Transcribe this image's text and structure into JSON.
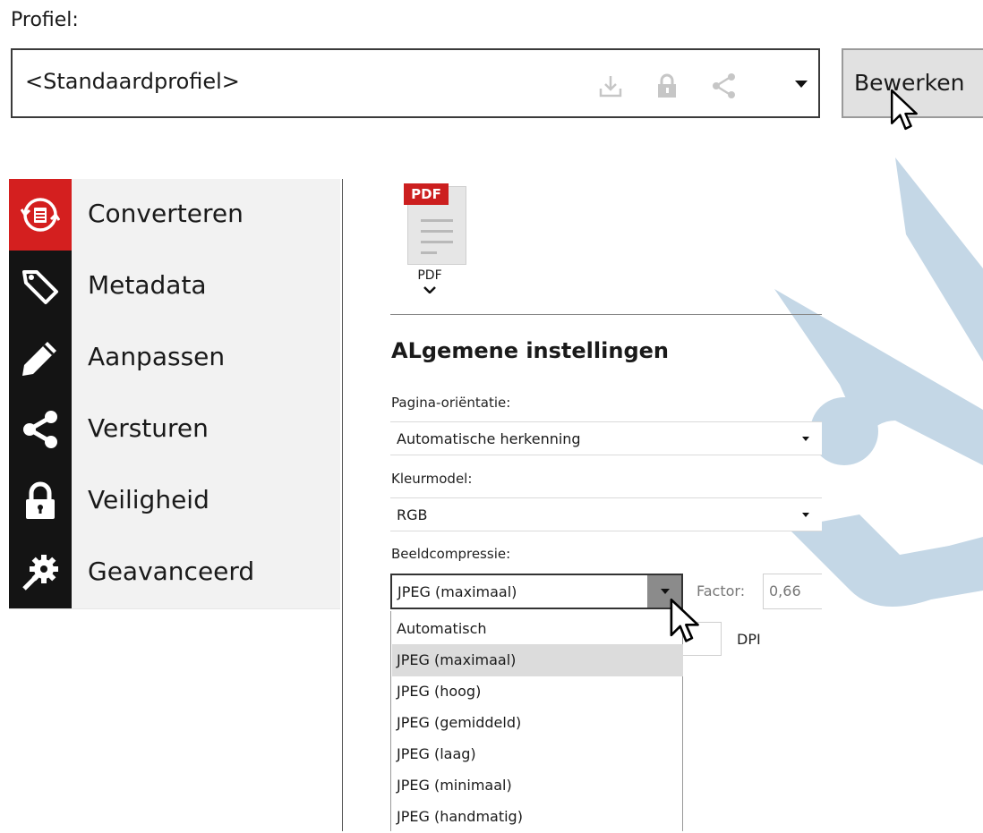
{
  "profile": {
    "label": "Profiel:",
    "selected": "<Standaardprofiel>",
    "icons": [
      "download-icon",
      "lock-icon",
      "share-icon"
    ],
    "edit_label": "Bewerken"
  },
  "sidebar": {
    "items": [
      {
        "label": "Converteren",
        "icon": "convert-icon",
        "active": true
      },
      {
        "label": "Metadata",
        "icon": "tag-icon",
        "active": false
      },
      {
        "label": "Aanpassen",
        "icon": "pencil-icon",
        "active": false
      },
      {
        "label": "Versturen",
        "icon": "share-icon",
        "active": false
      },
      {
        "label": "Veiligheid",
        "icon": "lock-icon",
        "active": false
      },
      {
        "label": "Geavanceerd",
        "icon": "gear-icon",
        "active": false
      }
    ]
  },
  "output_format": {
    "badge": "PDF",
    "name": "PDF"
  },
  "section": {
    "title": "ALgemene instellingen"
  },
  "fields": {
    "orientation": {
      "label": "Pagina-oriëntatie:",
      "value": "Automatische herkenning"
    },
    "color_model": {
      "label": "Kleurmodel:",
      "value": "RGB"
    },
    "compression": {
      "label": "Beeldcompressie:",
      "value": "JPEG (maximaal)",
      "factor_label": "Factor:",
      "factor_value": "0,66",
      "dpi_label": "DPI",
      "options": [
        "Automatisch",
        "JPEG (maximaal)",
        "JPEG (hoog)",
        "JPEG (gemiddeld)",
        "JPEG (laag)",
        "JPEG (minimaal)",
        "JPEG (handmatig)"
      ],
      "selected_index": 1
    }
  },
  "colors": {
    "accent": "#d41f1f",
    "icon_bg": "#141414",
    "watermark": "#c4d7e6"
  }
}
